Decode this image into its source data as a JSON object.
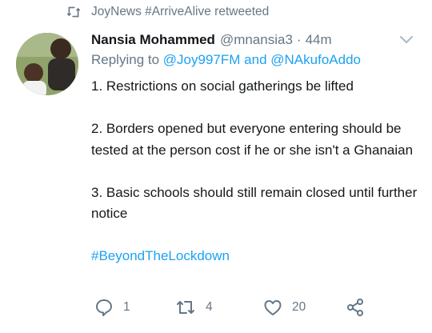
{
  "retweet_context": {
    "icon": "retweet-icon",
    "text": "JoyNews #ArriveAlive retweeted"
  },
  "tweet": {
    "author_name": "Nansia Mohammed",
    "handle": "@mnansia3",
    "separator": "·",
    "time": "44m",
    "replying_prefix": "Replying to",
    "mention_1": "@Joy997FM",
    "connector": "and",
    "mention_2": "@NAkufoAddo",
    "lines": [
      "1. Restrictions on social gatherings be lifted",
      "2. Borders opened but everyone entering should be tested at the person cost if he or she isn't a Ghanaian",
      "3. Basic schools should still remain closed until further notice"
    ],
    "hashtag": "#BeyondTheLockdown"
  },
  "actions": {
    "reply_count": "1",
    "retweet_count": "4",
    "like_count": "20"
  },
  "colors": {
    "accent": "#1da1f2",
    "secondary_text": "#657786",
    "primary_text": "#14171a"
  }
}
